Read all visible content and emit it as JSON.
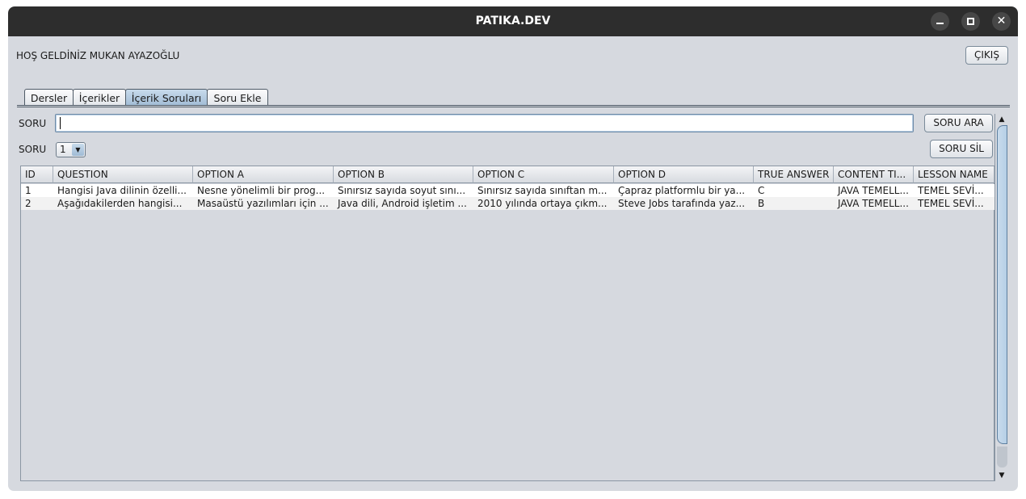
{
  "window": {
    "title": "PATIKA.DEV"
  },
  "header": {
    "welcome": "HOŞ GELDİNİZ MUKAN AYAZOĞLU",
    "exit_label": "ÇIKIŞ"
  },
  "tabs": [
    {
      "label": "Dersler",
      "active": false
    },
    {
      "label": "İçerikler",
      "active": false
    },
    {
      "label": "İçerik Soruları",
      "active": true
    },
    {
      "label": "Soru Ekle",
      "active": false
    }
  ],
  "search": {
    "label": "SORU",
    "value": "",
    "button_label": "SORU ARA"
  },
  "select": {
    "label": "SORU",
    "value": "1",
    "delete_label": "SORU SİL"
  },
  "table": {
    "columns": [
      "ID",
      "QUESTION",
      "OPTION A",
      "OPTION B",
      "OPTION C",
      "OPTION D",
      "TRUE ANSWER",
      "CONTENT TI...",
      "LESSON NAME"
    ],
    "rows": [
      [
        "1",
        "Hangisi Java dilinin özelli...",
        "Nesne yönelimli bir prog...",
        "Sınırsız sayıda soyut sını...",
        "Sınırsız sayıda sınıftan m...",
        "Çapraz platformlu bir ya...",
        "C",
        "JAVA TEMELL...",
        "TEMEL SEVİ..."
      ],
      [
        "2",
        "Aşağıdakilerden hangisi...",
        "Masaüstü yazılımları için ...",
        "Java dili, Android işletim ...",
        "2010 yılında ortaya çıkm...",
        "Steve Jobs tarafında yaz...",
        "B",
        "JAVA TEMELL...",
        "TEMEL SEVİ..."
      ]
    ]
  },
  "icons": [
    "minimize-icon",
    "maximize-icon",
    "close-icon",
    "chevron-down-icon",
    "scroll-up-icon",
    "scroll-down-icon"
  ]
}
